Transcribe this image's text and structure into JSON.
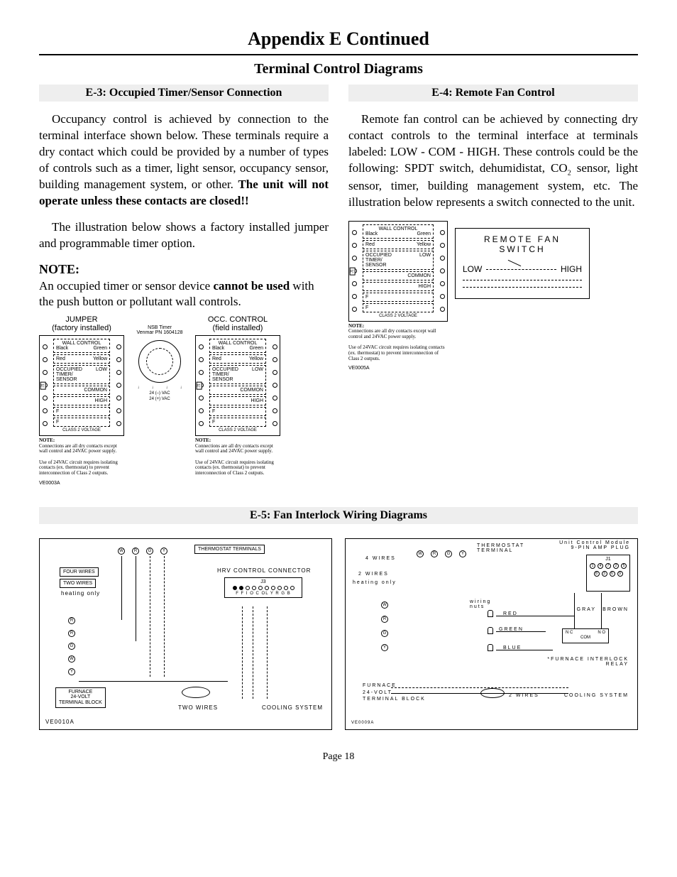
{
  "title": "Appendix E Continued",
  "subtitle": "Terminal Control Diagrams",
  "e3": {
    "heading": "E-3: Occupied Timer/Sensor Connection",
    "para1_a": "Occupancy control is achieved by connection to the terminal interface shown below. These terminals require a dry contact which could be provided by a number of types of controls such as a timer, light sensor, occupancy sensor, building management system, or other. ",
    "para1_b": "The unit will not operate unless these contacts are closed!!",
    "para2": "The illustration below shows a factory installed jumper and programmable timer option.",
    "note_head": "NOTE:",
    "note_a": "An occupied timer or sensor device ",
    "note_b": "cannot be used",
    "note_c": " with the push button or pollutant wall controls.",
    "jumper_label_1": "JUMPER",
    "jumper_label_2": "(factory installed)",
    "occ_label_1": "OCC. CONTROL",
    "occ_label_2": "(field installed)",
    "timer_caption_1": "NSB Timer",
    "timer_caption_2": "Venmar PN 1604128",
    "timer_leg_a": "24 (–) VAC",
    "timer_leg_b": "24 (+) VAC",
    "tb": {
      "wall_control": "WALL CONTROL",
      "black": "Black",
      "green": "Green",
      "red": "Red",
      "yellow": "Yellow",
      "occ": "OCCUPIED TIMER/ SENSOR",
      "low": "LOW",
      "common": "COMMON",
      "high": "HIGH",
      "f1": "F",
      "f2": "F",
      "class2": "CLASS 2 VOLTAGE",
      "j1": "J1",
      "note_head": "NOTE:",
      "note_1": "Connections are all dry contacts except wall control and 24VAC power supply.",
      "note_2": "Use of 24VAC circuit requires isolating contacts (ex. thermostat) to prevent interconnection of Class 2 outputs."
    },
    "fig_left": "VE0003A"
  },
  "e4": {
    "heading": "E-4: Remote Fan Control",
    "para_a": "Remote fan control can be achieved by connecting dry contact controls to the terminal interface at terminals labeled: LOW - COM - HIGH. These controls could be the following: SPDT switch, dehumidistat, CO",
    "para_sub": "2",
    "para_b": " sensor, light sensor, timer, building management system, etc. The illustration below represents a switch connected to the unit.",
    "switch_title": "REMOTE  FAN  SWITCH",
    "sw_low": "LOW",
    "sw_high": "HIGH",
    "fig": "VE0005A"
  },
  "e5": {
    "heading": "E-5: Fan Interlock Wiring Diagrams",
    "left": {
      "thermo": "THERMOSTAT TERMINALS",
      "four": "FOUR WIRES",
      "two": "TWO WIRES",
      "heating": "heating only",
      "hrv": "HRV CONTROL CONNECTOR",
      "j3": "J3",
      "pins": "F F   I O C OL Y  R  G  B",
      "furn1": "FURNACE",
      "furn2": "24-VOLT",
      "furn3": "TERMINAL BLOCK",
      "twires": "TWO WIRES",
      "cooling": "COOLING SYSTEM",
      "fig": "VE0010A"
    },
    "right": {
      "thermo": "THERMOSTAT TERMINAL",
      "ucm1": "Unit Control Module",
      "ucm2": "9-PIN AMP PLUG",
      "j1": "J1",
      "four": "4 WIRES",
      "two": "2 WIRES",
      "heating": "heating only",
      "nuts": "wiring nuts",
      "red": "RED",
      "green": "GREEN",
      "blue": "BLUE",
      "gray": "GRAY",
      "brown": "BROWN",
      "nc": "N C",
      "no": "N O",
      "com": "COM",
      "relay": "*FURNACE INTERLOCK RELAY",
      "furn1": "FURNACE",
      "furn2": "24-VOLT",
      "furn3": "TERMINAL BLOCK",
      "twires": "2 WIRES",
      "cooling": "COOLING SYSTEM",
      "fig": "VE0009A"
    }
  },
  "footer": "Page 18"
}
